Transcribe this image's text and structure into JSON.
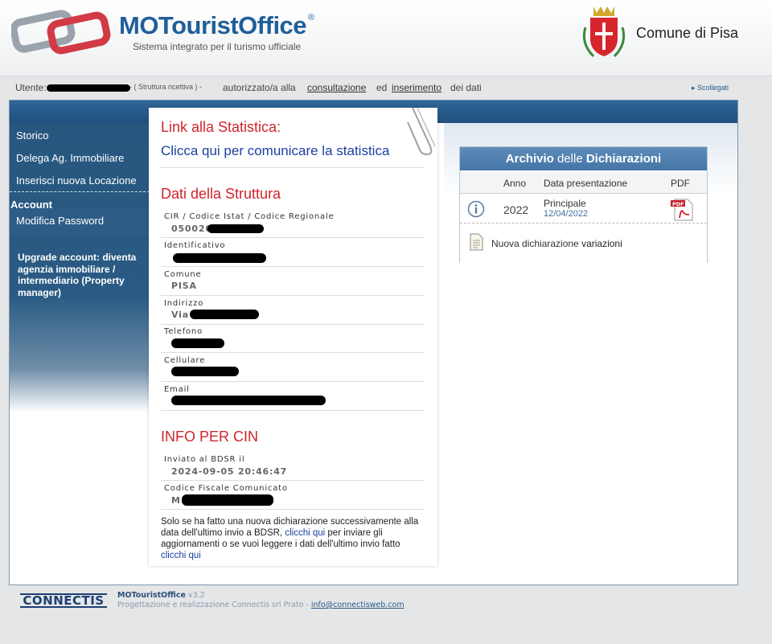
{
  "header": {
    "brand": "MOTouristOffice",
    "brand_mark": "®",
    "tagline": "Sistema integrato per il turismo ufficiale",
    "municipality": "Comune di Pisa"
  },
  "userbar": {
    "user_label": "Utente:",
    "role": "- ( Struttura ricettiva ) -",
    "authorized_text": "autorizzato/a alla",
    "consultation": "consultazione",
    "and_text": "ed",
    "insertion": "inserimento",
    "data_text": "dei dati",
    "logout": "Scollegati"
  },
  "sidebar": {
    "items": [
      {
        "label": "Storico"
      },
      {
        "label": "Delega Ag. Immobiliare"
      },
      {
        "label": "Inserisci nuova Locazione"
      }
    ],
    "account_heading": "Account",
    "change_password": "Modifica Password",
    "upgrade": "Upgrade account: diventa agenzia immobiliare / intermediario (Property manager)"
  },
  "statistics": {
    "heading": "Link alla Statistica:",
    "link": "Clicca qui per comunicare la statistica"
  },
  "structure": {
    "heading": "Dati della Struttura",
    "fields": [
      {
        "label": "CIR / Codice Istat / Codice Regionale",
        "value": "050026"
      },
      {
        "label": "Identificativo",
        "value": ""
      },
      {
        "label": "Comune",
        "value": "PISA"
      },
      {
        "label": "Indirizzo",
        "value": "Via"
      },
      {
        "label": "Telefono",
        "value": ""
      },
      {
        "label": "Cellulare",
        "value": ""
      },
      {
        "label": "Email",
        "value": ""
      }
    ]
  },
  "cin": {
    "heading": "INFO PER CIN",
    "fields": [
      {
        "label": "Inviato al BDSR il",
        "value": "2024-09-05 20:46:47"
      },
      {
        "label": "Codice Fiscale Comunicato",
        "value": "M"
      }
    ],
    "note_1": "Solo se ha fatto una nuova dichiarazione successivamente alla data dell'ultimo invio a BDSR,",
    "note_link_1": "clicchi qui",
    "note_2": "per inviare gli aggiornamenti o se vuoi leggere i dati dell'ultimo invio fatto",
    "note_link_2": "clicchi qui"
  },
  "archive": {
    "title_a": "Archivio",
    "title_b": "delle",
    "title_c": "Dichiarazioni",
    "col_year": "Anno",
    "col_date": "Data presentazione",
    "col_pdf": "PDF",
    "rows": [
      {
        "year": "2022",
        "type": "Principale",
        "date": "12/04/2022"
      }
    ],
    "new_text": "Nuova dichiarazione",
    "new_bold": "variazioni"
  },
  "footer": {
    "company": "CONNECTIS",
    "product": "MOTouristOffice",
    "version": "v3.2",
    "credits": "Progettazione e realizzazione Connectis srl Prato -",
    "email": "info@connectisweb.com"
  }
}
